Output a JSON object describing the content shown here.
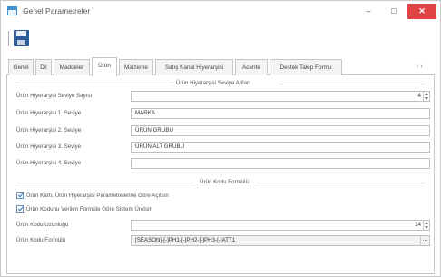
{
  "window": {
    "title": "Genel Parametreler",
    "controls": {
      "minimize": "–",
      "maximize": "□",
      "close": "✕"
    },
    "close_color": "#e04343"
  },
  "toolbar": {
    "save_icon": "save-icon"
  },
  "tabs": [
    {
      "label": "Genel"
    },
    {
      "label": "Dil"
    },
    {
      "label": "Maddeler"
    },
    {
      "label": "Ürün",
      "active": true
    },
    {
      "label": "Malzeme"
    },
    {
      "label": "Satış Kanal Hiyerarşisi"
    },
    {
      "label": "Acente"
    },
    {
      "label": "Destek Talep Formu"
    }
  ],
  "tab_more": "‹ ›",
  "hierarchy_section": {
    "title": "Ürün Hiyerarşisi Seviye Adları",
    "level_count_label": "Ürün Hiyerarşisi Seviye Sayısı",
    "level_count_value": "4",
    "levels": [
      {
        "label": "Ürün Hiyerarşisi 1. Seviye",
        "value": "MARKA"
      },
      {
        "label": "Ürün Hiyerarşisi 2. Seviye",
        "value": "ÜRÜN GRUBU"
      },
      {
        "label": "Ürün Hiyerarşisi 3. Seviye",
        "value": "ÜRÜN ALT GRUBU"
      },
      {
        "label": "Ürün Hiyerarşisi 4. Seviye",
        "value": ""
      }
    ]
  },
  "code_section": {
    "title": "Ürün Kodu Formülü",
    "checkbox1_label": "Ürün Kartı, Ürün Hiyerarşisi Parametrelerine Göre Açılsın",
    "checkbox2_label": "Ürün Kodunu Verilen Formüle Göre Sistem Üretsin",
    "length_label": "Ürün Kodu Uzunluğu",
    "length_value": "14",
    "formula_label": "Ürün Kodu Formülü",
    "formula_value": "[SEASON]-[-]PH1-[-]PH2-[-]PH3-[-]ATT1"
  }
}
